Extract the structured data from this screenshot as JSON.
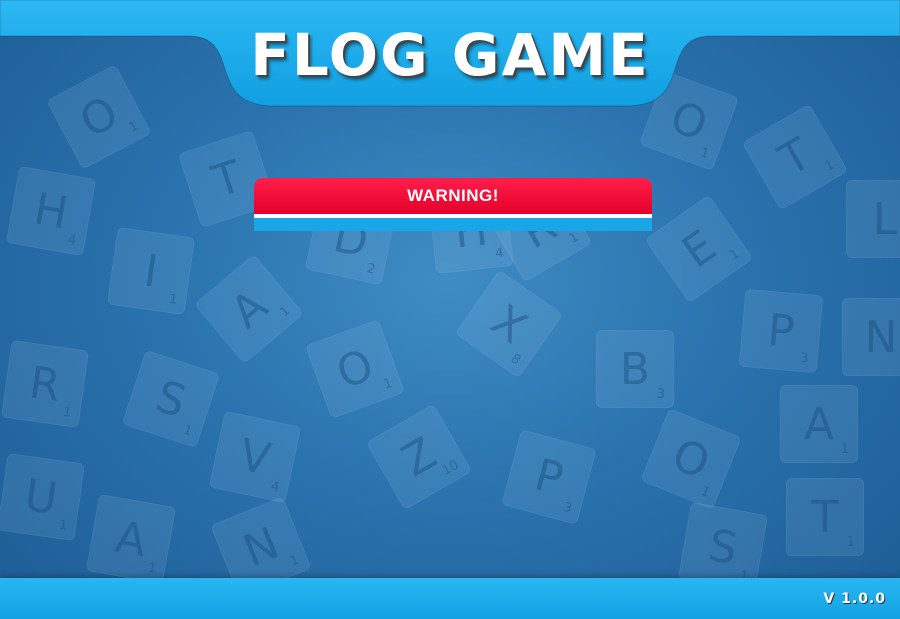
{
  "header": {
    "title": "FLOG GAME"
  },
  "warning": {
    "title": "WARNING!"
  },
  "footer": {
    "version": "V 1.0.0"
  },
  "colors": {
    "background": "#2a73ae",
    "bar": "#19a5e6",
    "warning_header": "#e4002b",
    "text": "#ffffff"
  },
  "background_tiles": [
    {
      "letter": "O",
      "value": "1"
    },
    {
      "letter": "H",
      "value": "4"
    },
    {
      "letter": "T",
      "value": "1"
    },
    {
      "letter": "I",
      "value": "1"
    },
    {
      "letter": "D",
      "value": "2"
    },
    {
      "letter": "H",
      "value": "4"
    },
    {
      "letter": "O",
      "value": "1"
    },
    {
      "letter": "T",
      "value": "1"
    },
    {
      "letter": "E",
      "value": "1"
    },
    {
      "letter": "A",
      "value": "1"
    },
    {
      "letter": "X",
      "value": "8"
    },
    {
      "letter": "R",
      "value": "1"
    },
    {
      "letter": "P",
      "value": "3"
    },
    {
      "letter": "N",
      "value": "1"
    },
    {
      "letter": "O",
      "value": "1"
    },
    {
      "letter": "B",
      "value": "3"
    },
    {
      "letter": "S",
      "value": "1"
    },
    {
      "letter": "A",
      "value": "1"
    },
    {
      "letter": "V",
      "value": "4"
    },
    {
      "letter": "Z",
      "value": "10"
    },
    {
      "letter": "O",
      "value": "1"
    },
    {
      "letter": "U",
      "value": "1"
    },
    {
      "letter": "P",
      "value": "3"
    },
    {
      "letter": "T",
      "value": "1"
    },
    {
      "letter": "A",
      "value": "1"
    },
    {
      "letter": "N",
      "value": "1"
    },
    {
      "letter": "S",
      "value": "1"
    },
    {
      "letter": "L",
      "value": "1"
    },
    {
      "letter": "R",
      "value": "1"
    }
  ]
}
